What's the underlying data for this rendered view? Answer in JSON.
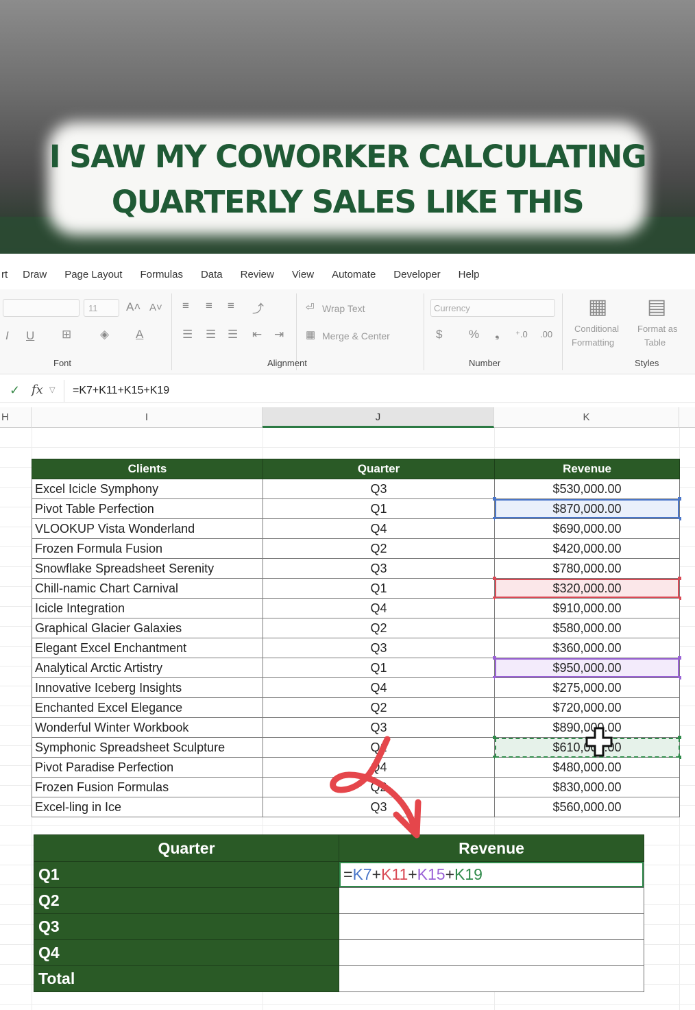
{
  "caption": {
    "line1": "I SAW MY COWORKER CALCULATING",
    "line2": "QUARTERLY SALES LIKE THIS"
  },
  "menu": [
    "rt",
    "Draw",
    "Page Layout",
    "Formulas",
    "Data",
    "Review",
    "View",
    "Automate",
    "Developer",
    "Help"
  ],
  "ribbon": {
    "font_size": "11",
    "wrap_text": "Wrap Text",
    "merge_center": "Merge & Center",
    "number_format": "Currency",
    "conditional_formatting_1": "Conditional",
    "conditional_formatting_2": "Formatting",
    "format_as_table_1": "Format as",
    "format_as_table_2": "Table",
    "groups": {
      "font": "Font",
      "alignment": "Alignment",
      "number": "Number",
      "styles": "Styles"
    }
  },
  "formula_bar": {
    "formula": "=K7+K11+K15+K19"
  },
  "columns": {
    "h": "H",
    "i": "I",
    "j": "J",
    "k": "K"
  },
  "data_table": {
    "headers": [
      "Clients",
      "Quarter",
      "Revenue"
    ],
    "rows": [
      [
        "Excel Icicle Symphony",
        "Q3",
        "$530,000.00"
      ],
      [
        "Pivot Table Perfection",
        "Q1",
        "$870,000.00"
      ],
      [
        "VLOOKUP Vista Wonderland",
        "Q4",
        "$690,000.00"
      ],
      [
        "Frozen Formula Fusion",
        "Q2",
        "$420,000.00"
      ],
      [
        "Snowflake Spreadsheet Serenity",
        "Q3",
        "$780,000.00"
      ],
      [
        "Chill-namic Chart Carnival",
        "Q1",
        "$320,000.00"
      ],
      [
        "Icicle Integration",
        "Q4",
        "$910,000.00"
      ],
      [
        "Graphical Glacier Galaxies",
        "Q2",
        "$580,000.00"
      ],
      [
        "Elegant Excel Enchantment",
        "Q3",
        "$360,000.00"
      ],
      [
        "Analytical Arctic Artistry",
        "Q1",
        "$950,000.00"
      ],
      [
        "Innovative Iceberg Insights",
        "Q4",
        "$275,000.00"
      ],
      [
        "Enchanted Excel Elegance",
        "Q2",
        "$720,000.00"
      ],
      [
        "Wonderful Winter Workbook",
        "Q3",
        "$890,000.00"
      ],
      [
        "Symphonic Spreadsheet Sculpture",
        "Q1",
        "$610,000.00"
      ],
      [
        "Pivot Paradise Perfection",
        "Q4",
        "$480,000.00"
      ],
      [
        "Frozen Fusion Formulas",
        "Q2",
        "$830,000.00"
      ],
      [
        "Excel-ling in Ice",
        "Q3",
        "$560,000.00"
      ]
    ]
  },
  "summary_table": {
    "headers": [
      "Quarter",
      "Revenue"
    ],
    "rows": [
      "Q1",
      "Q2",
      "Q3",
      "Q4",
      "Total"
    ],
    "formula_parts": [
      "=",
      "K7",
      "+",
      "K11",
      "+",
      "K15",
      "+",
      "K19"
    ]
  },
  "colors": {
    "header_green": "#2a5a26",
    "ref_blue": "#4a76c9",
    "ref_red": "#d94a55",
    "ref_purple": "#9a62d6",
    "ref_green": "#2f8a4a",
    "annotation_red": "#e5464b"
  }
}
